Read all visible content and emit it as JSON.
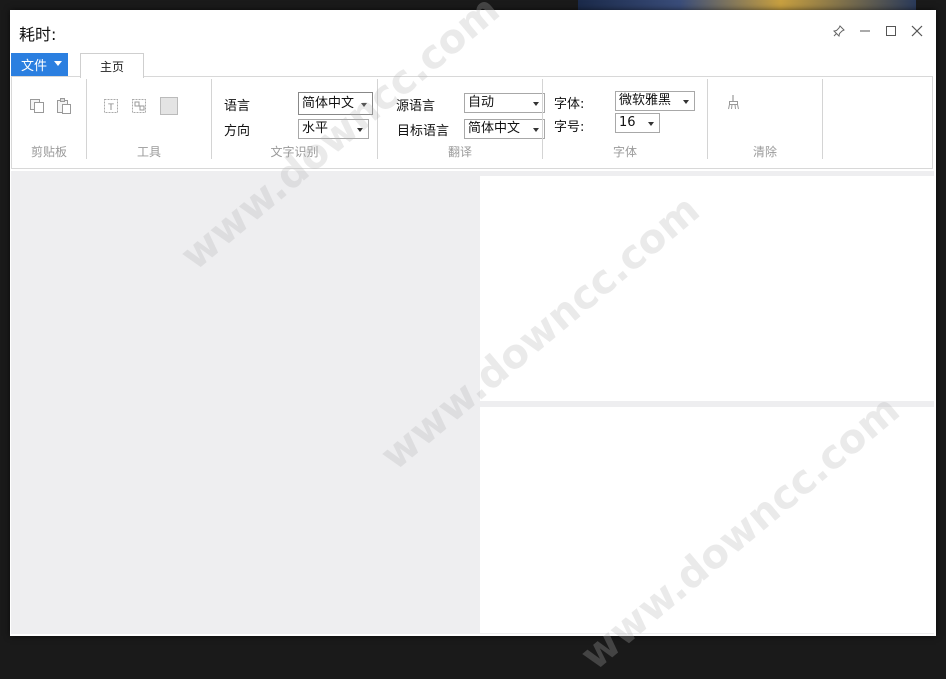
{
  "window": {
    "title": "耗时:"
  },
  "file_menu": {
    "label": "文件"
  },
  "tabs": [
    {
      "label": "主页"
    }
  ],
  "groups": {
    "clipboard": {
      "label": "剪贴板"
    },
    "tools": {
      "label": "工具"
    },
    "ocr": {
      "label": "文字识别",
      "language_label": "语言",
      "language_value": "简体中文",
      "direction_label": "方向",
      "direction_value": "水平"
    },
    "translate": {
      "label": "翻译",
      "source_label": "源语言",
      "source_value": "自动",
      "target_label": "目标语言",
      "target_value": "简体中文"
    },
    "font": {
      "label": "字体",
      "font_label": "字体:",
      "font_value": "微软雅黑",
      "size_label": "字号:",
      "size_value": "16"
    },
    "clear": {
      "label": "清除"
    }
  },
  "watermark": {
    "text": "www.downcc.com"
  },
  "colors": {
    "accent": "#2b7fe0",
    "panel_bg": "#eeeef0",
    "group_label": "#9a9a9a"
  }
}
